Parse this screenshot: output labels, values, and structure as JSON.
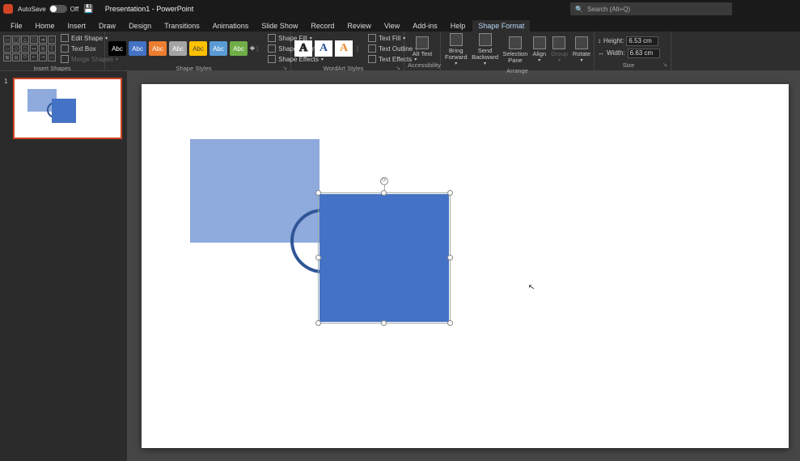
{
  "titlebar": {
    "autosave_label": "AutoSave",
    "autosave_state": "Off",
    "doc_name": "Presentation1 - PowerPoint",
    "search_placeholder": "Search (Alt+Q)"
  },
  "tabs": {
    "file": "File",
    "home": "Home",
    "insert": "Insert",
    "draw": "Draw",
    "design": "Design",
    "transitions": "Transitions",
    "animations": "Animations",
    "slideshow": "Slide Show",
    "record": "Record",
    "review": "Review",
    "view": "View",
    "addins": "Add-ins",
    "help": "Help",
    "shapeformat": "Shape Format"
  },
  "ribbon": {
    "insert_shapes": {
      "edit_shape": "Edit Shape",
      "text_box": "Text Box",
      "merge": "Merge Shapes",
      "group_label": "Insert Shapes"
    },
    "shape_styles": {
      "fill": "Shape Fill",
      "outline": "Shape Outline",
      "effects": "Shape Effects",
      "group_label": "Shape Styles",
      "thumb_text": "Abc"
    },
    "wordart": {
      "group_label": "WordArt Styles",
      "text_fill": "Text Fill",
      "text_outline": "Text Outline",
      "text_effects": "Text Effects",
      "sample": "A"
    },
    "accessibility": {
      "alt_text": "Alt Text",
      "group_label": "Accessibility"
    },
    "arrange": {
      "bring_forward": "Bring Forward",
      "send_backward": "Send Backward",
      "selection_pane": "Selection Pane",
      "align": "Align",
      "group": "Group",
      "rotate": "Rotate",
      "group_label": "Arrange"
    },
    "size": {
      "height_label": "Height:",
      "width_label": "Width:",
      "height_val": "6.53 cm",
      "width_val": "6.63 cm",
      "group_label": "Size"
    }
  },
  "thumbnails": {
    "slide1_num": "1"
  }
}
